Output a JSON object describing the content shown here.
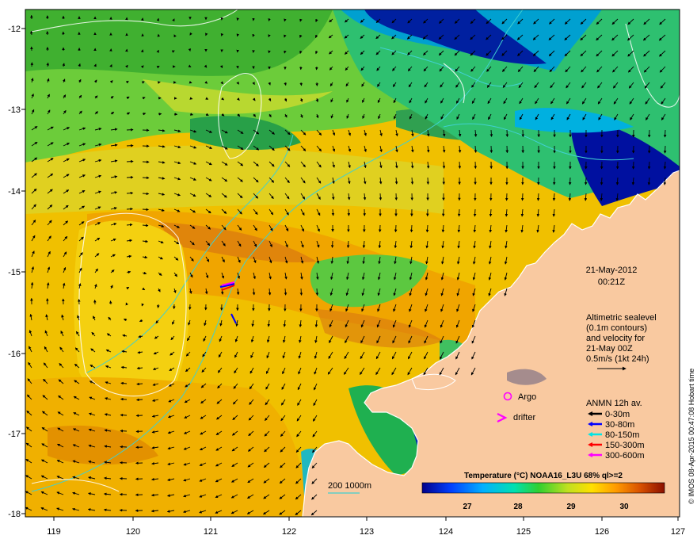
{
  "map": {
    "date": "21-May-2012",
    "time": "00:21Z",
    "info_lines": [
      "Altimetric sealevel",
      "(0.1m contours)",
      "and velocity for",
      "21-May 00Z",
      "0.5m/s (1kt 24h)"
    ],
    "x_ticks": [
      "119",
      "120",
      "121",
      "122",
      "123",
      "124",
      "125",
      "126",
      "127"
    ],
    "y_ticks": [
      "-12",
      "-13",
      "-14",
      "-15",
      "-16",
      "-17",
      "-18"
    ],
    "markers": {
      "argo": "Argo",
      "drifter": "drifter"
    },
    "depth_legend": "200  1000m",
    "anmn": {
      "title": "ANMN 12h av.",
      "items": [
        {
          "label": "0-30m",
          "color": "#000000"
        },
        {
          "label": "30-80m",
          "color": "#0000ff"
        },
        {
          "label": "80-150m",
          "color": "#00e5e5"
        },
        {
          "label": "150-300m",
          "color": "#ff0000"
        },
        {
          "label": "300-600m",
          "color": "#ff00ff"
        }
      ]
    },
    "colorbar": {
      "title": "Temperature (°C) NOAA16_L3U 68% ql>=2",
      "ticks": [
        "27",
        "28",
        "29",
        "30"
      ]
    },
    "credit": "© IMOS 08-Apr-2015 00:47:08 Hobart time",
    "colors": {
      "land": "#f9c9a0",
      "contour": "#ffffff",
      "isobath": "#40d0d0"
    }
  }
}
